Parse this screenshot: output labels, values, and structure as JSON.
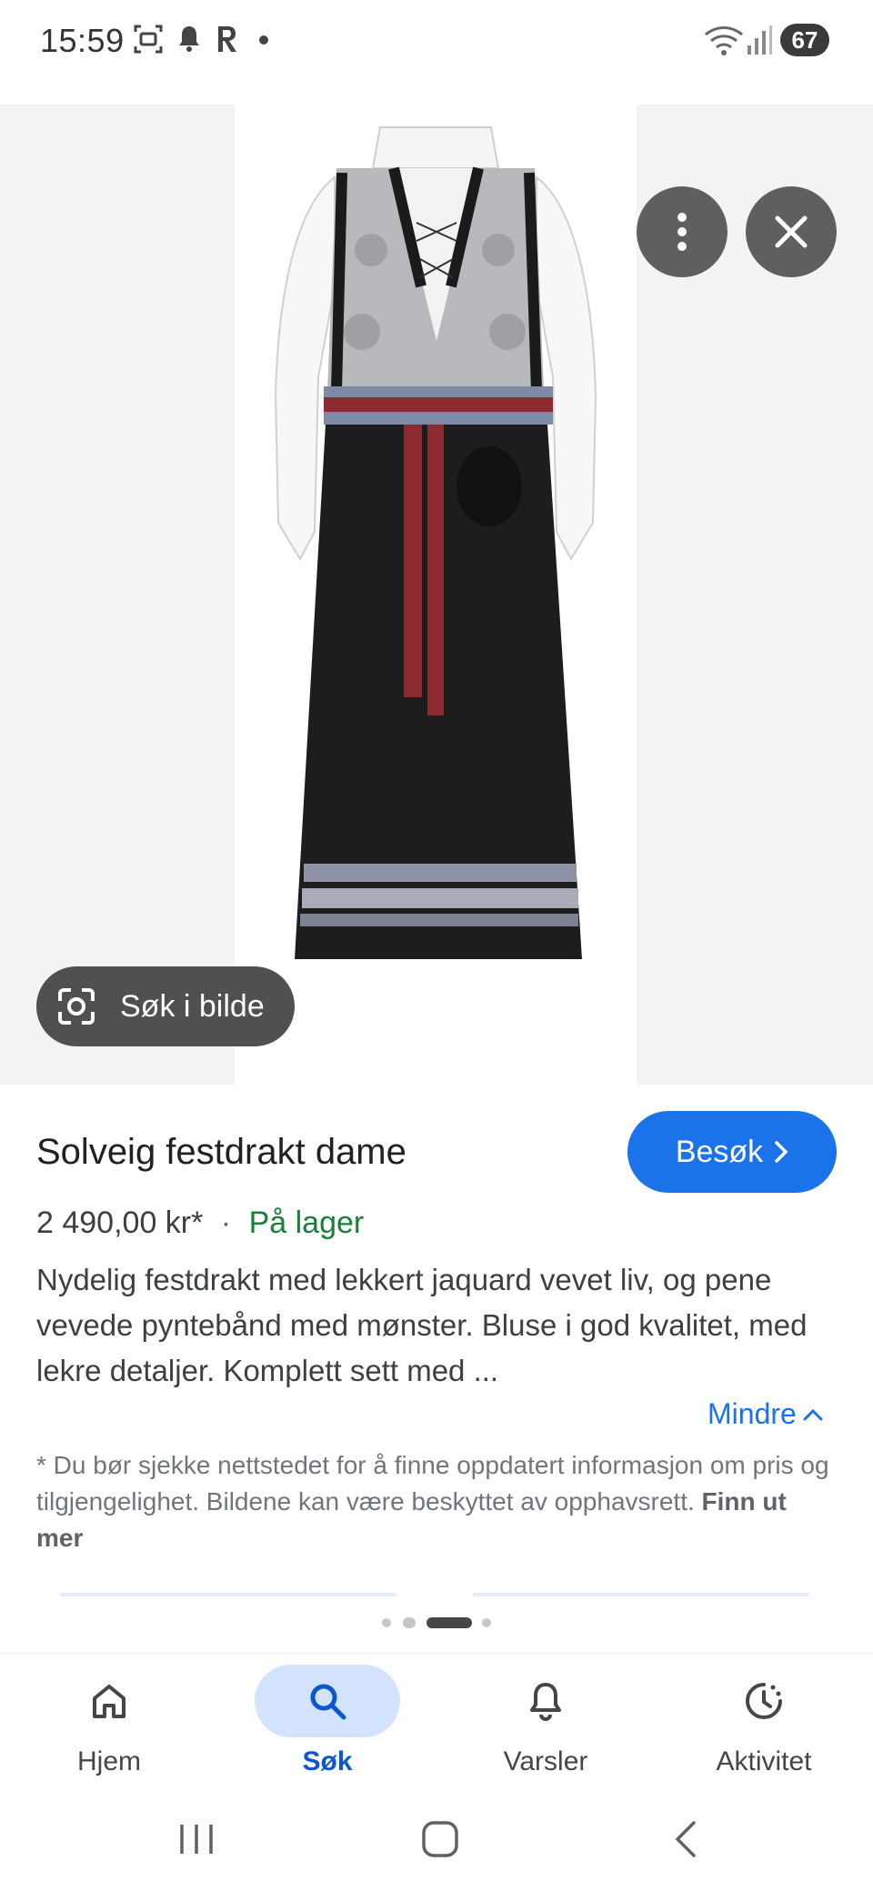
{
  "status_bar": {
    "time": "15:59",
    "battery": "67",
    "icons": [
      "screenshot-icon",
      "notification-bell-icon",
      "r-app-icon",
      "dot-icon",
      "wifi-icon",
      "signal-icon",
      "battery-icon"
    ]
  },
  "image_viewer": {
    "more_options_icon": "more-vert-icon",
    "close_icon": "close-icon",
    "lens_button_label": "Søk i bilde",
    "lens_icon": "google-lens-icon"
  },
  "product": {
    "title": "Solveig festdrakt dame",
    "visit_label": "Besøk",
    "price": "2 490,00 kr*",
    "separator": "·",
    "stock": "På lager",
    "description": "Nydelig festdrakt med lekkert jaquard vevet liv, og pene vevede pyntebånd med mønster. Bluse i god kvalitet, med lekre detaljer. Komplett sett med ...",
    "less_label": "Mindre",
    "disclaimer": "* Du bør sjekke nettstedet for å finne oppdatert informasjon om pris og tilgjengelighet. Bildene kan være beskyttet av opphavsrett.",
    "learn_more": "Finn ut mer"
  },
  "pager": {
    "count": 4,
    "active_index": 2
  },
  "bottom_nav": {
    "items": [
      {
        "label": "Hjem",
        "icon": "home-icon",
        "active": false
      },
      {
        "label": "Søk",
        "icon": "search-icon",
        "active": true
      },
      {
        "label": "Varsler",
        "icon": "bell-icon",
        "active": false
      },
      {
        "label": "Aktivitet",
        "icon": "activity-history-icon",
        "active": false
      }
    ]
  },
  "colors": {
    "accent": "#1a73e8",
    "in_stock": "#188038",
    "nav_active_bg": "#d3e3fd",
    "image_bg": "#f1f3f4"
  }
}
